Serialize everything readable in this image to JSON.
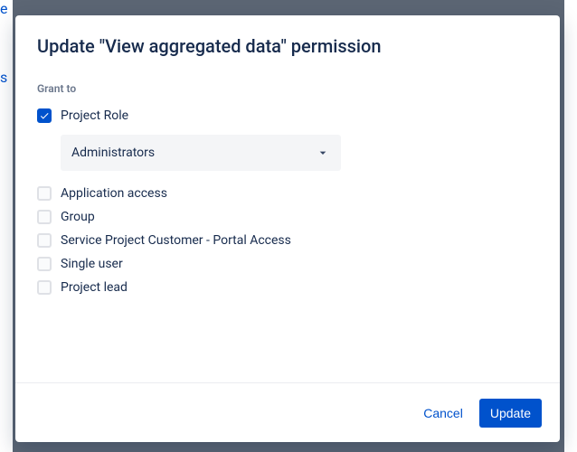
{
  "dialog": {
    "title": "Update \"View aggregated data\" permission",
    "section_label": "Grant to",
    "options": [
      {
        "label": "Project Role",
        "checked": true
      },
      {
        "label": "Application access",
        "checked": false
      },
      {
        "label": "Group",
        "checked": false
      },
      {
        "label": "Service Project Customer - Portal Access",
        "checked": false
      },
      {
        "label": "Single user",
        "checked": false
      },
      {
        "label": "Project lead",
        "checked": false
      }
    ],
    "role_select": {
      "value": "Administrators"
    }
  },
  "footer": {
    "cancel": "Cancel",
    "submit": "Update"
  }
}
